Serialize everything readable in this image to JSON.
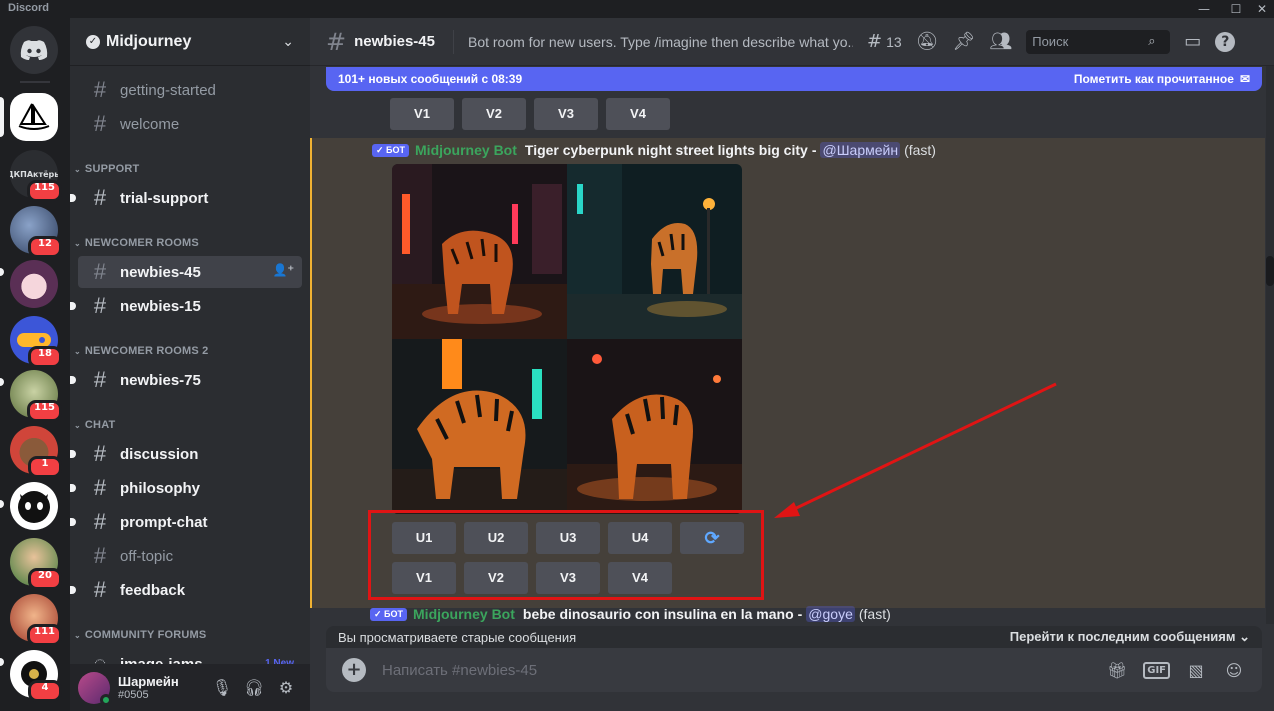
{
  "window": {
    "app_name": "Discord",
    "controls": {
      "minimize": "—",
      "maximize": "☐",
      "close": "✕"
    }
  },
  "servers": [
    {
      "name": "Discord Home",
      "badge": ""
    },
    {
      "name": "Midjourney",
      "badge": ""
    },
    {
      "name": "ДКПАктёры",
      "label": "ДКПАктёры",
      "badge": "115"
    },
    {
      "name": "Server",
      "badge": "12"
    },
    {
      "name": "Server",
      "badge": ""
    },
    {
      "name": "Server",
      "badge": "18"
    },
    {
      "name": "Server",
      "badge": "115"
    },
    {
      "name": "Server",
      "badge": "1"
    },
    {
      "name": "Server",
      "badge": ""
    },
    {
      "name": "Server",
      "badge": "20"
    },
    {
      "name": "Server",
      "badge": "111"
    },
    {
      "name": "Server",
      "badge": "4"
    }
  ],
  "sidebar": {
    "guild_name": "Midjourney",
    "channels_top": [
      {
        "label": "getting-started"
      },
      {
        "label": "welcome"
      }
    ],
    "categories": {
      "support": "SUPPORT",
      "newcomer_rooms": "NEWCOMER ROOMS",
      "newcomer_rooms_2": "NEWCOMER ROOMS 2",
      "chat": "CHAT",
      "community_forums": "COMMUNITY FORUMS"
    },
    "support_channels": [
      {
        "label": "trial-support"
      }
    ],
    "newcomer_channels": [
      {
        "label": "newbies-45"
      },
      {
        "label": "newbies-15"
      }
    ],
    "newcomer2_channels": [
      {
        "label": "newbies-75"
      }
    ],
    "chat_channels": [
      {
        "label": "discussion"
      },
      {
        "label": "philosophy"
      },
      {
        "label": "prompt-chat"
      },
      {
        "label": "off-topic"
      },
      {
        "label": "feedback"
      }
    ],
    "forums": [
      {
        "label": "image-jams",
        "badge": "1 New"
      }
    ]
  },
  "user": {
    "name": "Шармейн",
    "tag": "#0505"
  },
  "header": {
    "channel": "newbies-45",
    "topic": "Bot room for new users. Type /imagine then describe what yo...",
    "threads_count": "13",
    "search_placeholder": "Поиск"
  },
  "new_messages_bar": {
    "text": "101+ новых сообщений с 08:39",
    "mark_read": "Пометить как прочитанное"
  },
  "top_buttons": [
    "V1",
    "V2",
    "V3",
    "V4"
  ],
  "message1": {
    "badge": "✓ БОТ",
    "author": "Midjourney Bot",
    "prompt": "Tiger cyberpunk night street lights big city",
    "dash": "-",
    "mention": "@Шармейн",
    "mode": "(fast)",
    "upscale_buttons": [
      "U1",
      "U2",
      "U3",
      "U4"
    ],
    "reroll_icon": "⟳",
    "variation_buttons": [
      "V1",
      "V2",
      "V3",
      "V4"
    ]
  },
  "message2": {
    "badge": "✓ БОТ",
    "author": "Midjourney Bot",
    "prompt": "bebe dinosaurio con insulina en la mano",
    "dash": "-",
    "mention": "@goye",
    "mode": "(fast)"
  },
  "jump_bar": {
    "left": "Вы просматриваете старые сообщения",
    "right": "Перейти к последним сообщениям ⌄"
  },
  "composer": {
    "placeholder": "Написать #newbies-45",
    "gif": "GIF"
  },
  "colors": {
    "accent": "#5865f2",
    "bot_name": "#3ba55d",
    "highlight": "#e01414",
    "mention_bar": "#f0b232"
  }
}
